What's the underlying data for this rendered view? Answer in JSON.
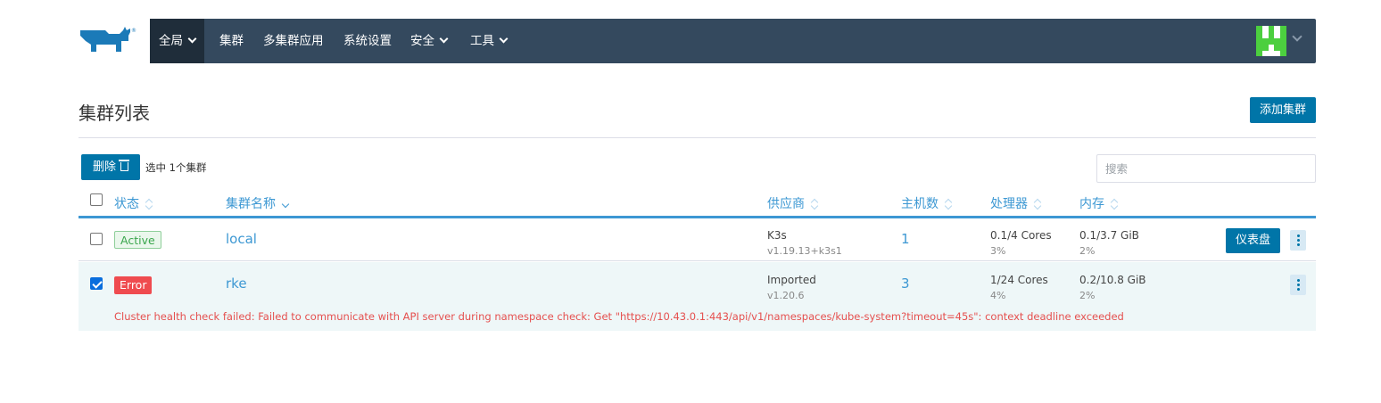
{
  "nav": {
    "items": [
      {
        "label": "全局",
        "dropdown": true,
        "active": true
      },
      {
        "label": "集群",
        "dropdown": false
      },
      {
        "label": "多集群应用",
        "dropdown": false
      },
      {
        "label": "系统设置",
        "dropdown": false
      },
      {
        "label": "安全",
        "dropdown": true
      },
      {
        "label": "工具",
        "dropdown": true
      }
    ],
    "logo_icon": "rancher-logo",
    "avatar_icon": "user-avatar"
  },
  "page": {
    "title": "集群列表",
    "add_button": "添加集群"
  },
  "bulk": {
    "delete_button": "删除",
    "selected_text": "选中 1个集群"
  },
  "search": {
    "placeholder": "搜索",
    "value": ""
  },
  "table": {
    "columns": [
      "状态",
      "集群名称",
      "供应商",
      "主机数",
      "处理器",
      "内存"
    ],
    "rows": [
      {
        "selected": false,
        "state": "Active",
        "name": "local",
        "provider": "K3s",
        "version": "v1.19.13+k3s1",
        "nodes": "1",
        "cpu": "0.1/4 Cores",
        "cpu_pct": "3%",
        "memory": "0.1/3.7 GiB",
        "memory_pct": "2%",
        "dashboard_button": "仪表盘"
      },
      {
        "selected": true,
        "state": "Error",
        "name": "rke",
        "provider": "Imported",
        "version": "v1.20.6",
        "nodes": "3",
        "cpu": "1/24 Cores",
        "cpu_pct": "4%",
        "memory": "0.2/10.8 GiB",
        "memory_pct": "2%",
        "error_message": "Cluster health check failed: Failed to communicate with API server during namespace check: Get \"https://10.43.0.1:443/api/v1/namespaces/kube-system?timeout=45s\": context deadline exceeded"
      }
    ]
  },
  "colors": {
    "nav_bg": "#34495e",
    "primary": "#0075a8",
    "link": "#3d98d3",
    "active_green": "#3aa64d",
    "error_red": "#ef4b4f"
  }
}
